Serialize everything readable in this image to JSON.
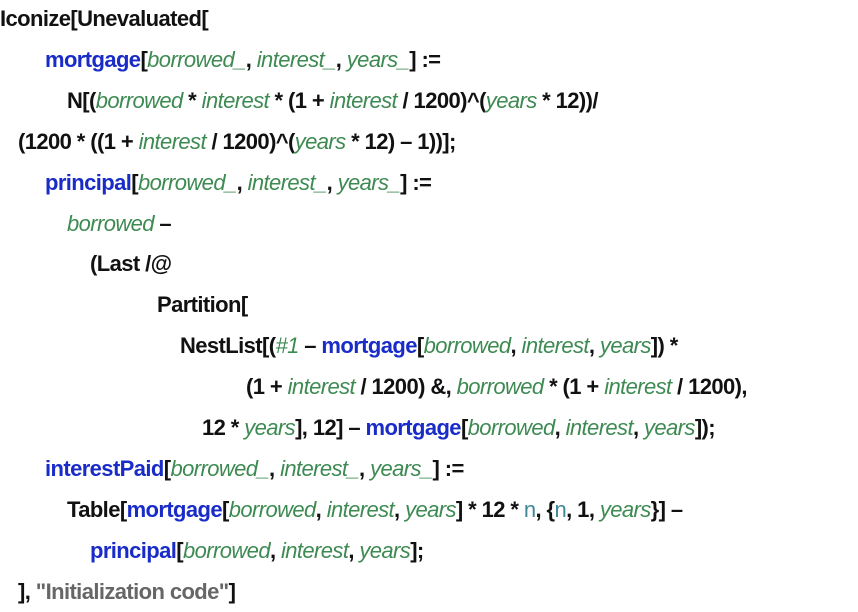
{
  "colors": {
    "text": "#111111",
    "function": "#1a2cc8",
    "variable": "#3d8a52",
    "local": "#3f8799",
    "string": "#666666"
  },
  "code_lines": [
    [
      [
        "k",
        "Iconize[Unevaluated["
      ]
    ],
    [
      [
        "f",
        "mortgage"
      ],
      [
        "k",
        "["
      ],
      [
        "v",
        "borrowed_"
      ],
      [
        "k",
        ", "
      ],
      [
        "v",
        "interest_"
      ],
      [
        "k",
        ", "
      ],
      [
        "v",
        "years_"
      ],
      [
        "k",
        "] :="
      ]
    ],
    [
      [
        "k",
        "N[("
      ],
      [
        "v",
        "borrowed"
      ],
      [
        "k",
        " * "
      ],
      [
        "v",
        "interest"
      ],
      [
        "k",
        " * (1 + "
      ],
      [
        "v",
        "interest"
      ],
      [
        "k",
        " / 1200)^("
      ],
      [
        "v",
        "years"
      ],
      [
        "k",
        " * 12))/"
      ]
    ],
    [
      [
        "k",
        "(1200 * ((1 + "
      ],
      [
        "v",
        "interest"
      ],
      [
        "k",
        " / 1200)^("
      ],
      [
        "v",
        "years"
      ],
      [
        "k",
        " * 12) – 1))];"
      ]
    ],
    [
      [
        "f",
        "principal"
      ],
      [
        "k",
        "["
      ],
      [
        "v",
        "borrowed_"
      ],
      [
        "k",
        ", "
      ],
      [
        "v",
        "interest_"
      ],
      [
        "k",
        ", "
      ],
      [
        "v",
        "years_"
      ],
      [
        "k",
        "] :="
      ]
    ],
    [
      [
        "v",
        "borrowed"
      ],
      [
        "k",
        " –"
      ]
    ],
    [
      [
        "k",
        "(Last /@"
      ]
    ],
    [
      [
        "k",
        "Partition["
      ]
    ],
    [
      [
        "k",
        "NestList[("
      ],
      [
        "v",
        "#1"
      ],
      [
        "k",
        " – "
      ],
      [
        "f",
        "mortgage"
      ],
      [
        "k",
        "["
      ],
      [
        "v",
        "borrowed"
      ],
      [
        "k",
        ", "
      ],
      [
        "v",
        "interest"
      ],
      [
        "k",
        ", "
      ],
      [
        "v",
        "years"
      ],
      [
        "k",
        "]) *"
      ]
    ],
    [
      [
        "k",
        "(1 + "
      ],
      [
        "v",
        "interest"
      ],
      [
        "k",
        " / 1200) &, "
      ],
      [
        "v",
        "borrowed"
      ],
      [
        "k",
        " * (1 + "
      ],
      [
        "v",
        "interest"
      ],
      [
        "k",
        " / 1200),"
      ]
    ],
    [
      [
        "k",
        "12 * "
      ],
      [
        "v",
        "years"
      ],
      [
        "k",
        "], 12] – "
      ],
      [
        "f",
        "mortgage"
      ],
      [
        "k",
        "["
      ],
      [
        "v",
        "borrowed"
      ],
      [
        "k",
        ", "
      ],
      [
        "v",
        "interest"
      ],
      [
        "k",
        ", "
      ],
      [
        "v",
        "years"
      ],
      [
        "k",
        "]);"
      ]
    ],
    [
      [
        "f",
        "interestPaid"
      ],
      [
        "k",
        "["
      ],
      [
        "v",
        "borrowed_"
      ],
      [
        "k",
        ", "
      ],
      [
        "v",
        "interest_"
      ],
      [
        "k",
        ", "
      ],
      [
        "v",
        "years_"
      ],
      [
        "k",
        "] :="
      ]
    ],
    [
      [
        "k",
        "Table["
      ],
      [
        "f",
        "mortgage"
      ],
      [
        "k",
        "["
      ],
      [
        "v",
        "borrowed"
      ],
      [
        "k",
        ", "
      ],
      [
        "v",
        "interest"
      ],
      [
        "k",
        ", "
      ],
      [
        "v",
        "years"
      ],
      [
        "k",
        "] * 12 * "
      ],
      [
        "n",
        "n"
      ],
      [
        "k",
        ", {"
      ],
      [
        "n",
        "n"
      ],
      [
        "k",
        ", 1, "
      ],
      [
        "v",
        "years"
      ],
      [
        "k",
        "}] –"
      ]
    ],
    [
      [
        "f",
        "principal"
      ],
      [
        "k",
        "["
      ],
      [
        "v",
        "borrowed"
      ],
      [
        "k",
        ", "
      ],
      [
        "v",
        "interest"
      ],
      [
        "k",
        ", "
      ],
      [
        "v",
        "years"
      ],
      [
        "k",
        "];"
      ]
    ],
    [
      [
        "k",
        "], "
      ],
      [
        "s",
        "\"Initialization code\""
      ],
      [
        "k",
        "]"
      ]
    ]
  ]
}
